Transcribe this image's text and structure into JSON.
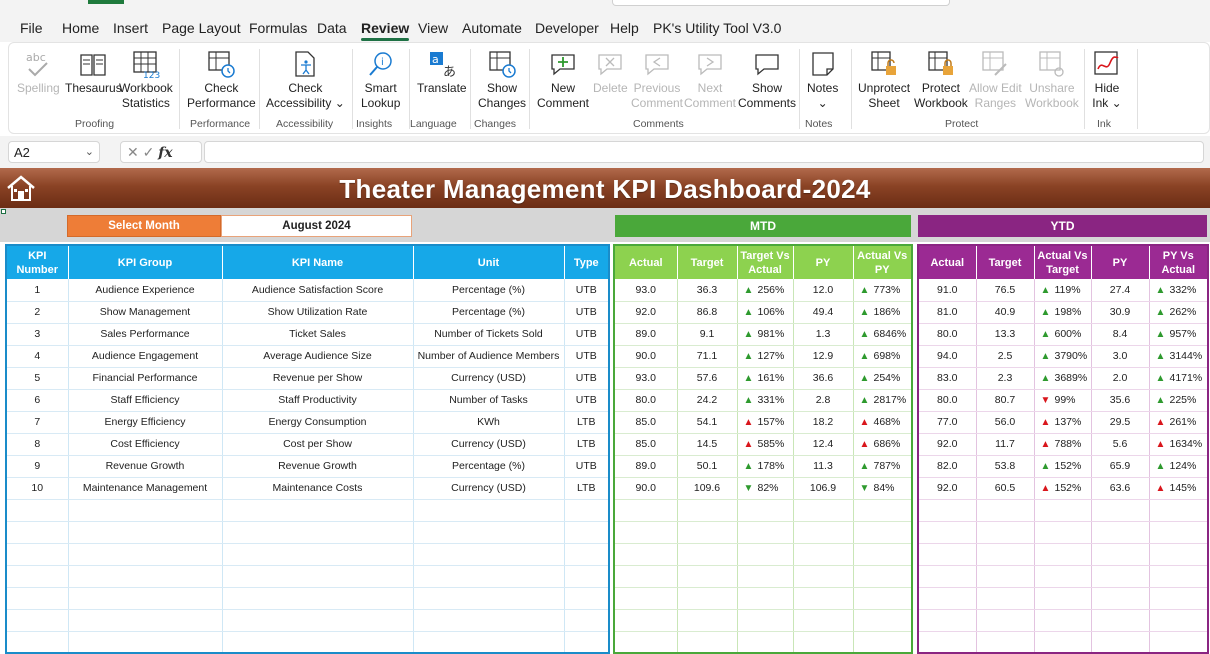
{
  "menu": {
    "tabs": [
      "File",
      "Home",
      "Insert",
      "Page Layout",
      "Formulas",
      "Data",
      "Review",
      "View",
      "Automate",
      "Developer",
      "Help",
      "PK's Utility Tool V3.0"
    ],
    "active": "Review"
  },
  "ribbon": {
    "buttons": {
      "spelling": "Spelling",
      "thesaurus": "Thesaurus",
      "workbook_stats_1": "Workbook",
      "workbook_stats_2": "Statistics",
      "check_perf_1": "Check",
      "check_perf_2": "Performance",
      "check_access_1": "Check",
      "check_access_2": "Accessibility",
      "smart_lookup_1": "Smart",
      "smart_lookup_2": "Lookup",
      "translate": "Translate",
      "show_changes_1": "Show",
      "show_changes_2": "Changes",
      "new_comment_1": "New",
      "new_comment_2": "Comment",
      "delete": "Delete",
      "previous_1": "Previous",
      "previous_2": "Comment",
      "next_1": "Next",
      "next_2": "Comment",
      "show_comments_1": "Show",
      "show_comments_2": "Comments",
      "notes": "Notes",
      "unprotect_1": "Unprotect",
      "unprotect_2": "Sheet",
      "protect_wb_1": "Protect",
      "protect_wb_2": "Workbook",
      "allow_edit_1": "Allow Edit",
      "allow_edit_2": "Ranges",
      "unshare_1": "Unshare",
      "unshare_2": "Workbook",
      "hide_ink_1": "Hide",
      "hide_ink_2": "Ink"
    },
    "groups": {
      "proofing": "Proofing",
      "performance": "Performance",
      "accessibility": "Accessibility",
      "insights": "Insights",
      "language": "Language",
      "changes": "Changes",
      "comments": "Comments",
      "notes": "Notes",
      "protect": "Protect",
      "ink": "Ink"
    }
  },
  "formula_bar": {
    "name_box": "A2",
    "fx": "fx",
    "formula": ""
  },
  "dashboard": {
    "title": "Theater Management KPI Dashboard-2024",
    "select_month_label": "Select Month",
    "select_month_value": "August 2024",
    "mtd_label": "MTD",
    "ytd_label": "YTD",
    "colors": {
      "banner": "#8a4325",
      "select_month": "#ee7d37",
      "kpi_header": "#16a8e8",
      "mtd": "#4aa83a",
      "mtd_header": "#8dd24f",
      "ytd": "#8a2582",
      "arrow_good": "#2e9a2e",
      "arrow_bad": "#d9161c"
    }
  },
  "kpi_headers": [
    "KPI Number",
    "KPI Group",
    "KPI Name",
    "Unit",
    "Type"
  ],
  "mtd_headers": [
    "Actual",
    "Target",
    "Target Vs Actual",
    "PY",
    "Actual Vs PY"
  ],
  "ytd_headers": [
    "Actual",
    "Target",
    "Actual Vs Target",
    "PY",
    "PY Vs Actual"
  ],
  "rows": [
    {
      "num": "1",
      "group": "Audience Experience",
      "name": "Audience Satisfaction Score",
      "unit": "Percentage (%)",
      "type": "UTB",
      "mtd": {
        "actual": "93.0",
        "target": "36.3",
        "tva": "256%",
        "tva_dir": "up-good",
        "py": "12.0",
        "avp": "773%",
        "avp_dir": "up-good"
      },
      "ytd": {
        "actual": "91.0",
        "target": "76.5",
        "avt": "119%",
        "avt_dir": "up-good",
        "py": "27.4",
        "pva": "332%",
        "pva_dir": "up-good"
      }
    },
    {
      "num": "2",
      "group": "Show Management",
      "name": "Show Utilization Rate",
      "unit": "Percentage (%)",
      "type": "UTB",
      "mtd": {
        "actual": "92.0",
        "target": "86.8",
        "tva": "106%",
        "tva_dir": "up-good",
        "py": "49.4",
        "avp": "186%",
        "avp_dir": "up-good"
      },
      "ytd": {
        "actual": "81.0",
        "target": "40.9",
        "avt": "198%",
        "avt_dir": "up-good",
        "py": "30.9",
        "pva": "262%",
        "pva_dir": "up-good"
      }
    },
    {
      "num": "3",
      "group": "Sales Performance",
      "name": "Ticket Sales",
      "unit": "Number of Tickets Sold",
      "type": "UTB",
      "mtd": {
        "actual": "89.0",
        "target": "9.1",
        "tva": "981%",
        "tva_dir": "up-good",
        "py": "1.3",
        "avp": "6846%",
        "avp_dir": "up-good"
      },
      "ytd": {
        "actual": "80.0",
        "target": "13.3",
        "avt": "600%",
        "avt_dir": "up-good",
        "py": "8.4",
        "pva": "957%",
        "pva_dir": "up-good"
      }
    },
    {
      "num": "4",
      "group": "Audience Engagement",
      "name": "Average Audience Size",
      "unit": "Number of Audience Members",
      "type": "UTB",
      "mtd": {
        "actual": "90.0",
        "target": "71.1",
        "tva": "127%",
        "tva_dir": "up-good",
        "py": "12.9",
        "avp": "698%",
        "avp_dir": "up-good"
      },
      "ytd": {
        "actual": "94.0",
        "target": "2.5",
        "avt": "3790%",
        "avt_dir": "up-good",
        "py": "3.0",
        "pva": "3144%",
        "pva_dir": "up-good"
      }
    },
    {
      "num": "5",
      "group": "Financial Performance",
      "name": "Revenue per Show",
      "unit": "Currency (USD)",
      "type": "UTB",
      "mtd": {
        "actual": "93.0",
        "target": "57.6",
        "tva": "161%",
        "tva_dir": "up-good",
        "py": "36.6",
        "avp": "254%",
        "avp_dir": "up-good"
      },
      "ytd": {
        "actual": "83.0",
        "target": "2.3",
        "avt": "3689%",
        "avt_dir": "up-good",
        "py": "2.0",
        "pva": "4171%",
        "pva_dir": "up-good"
      }
    },
    {
      "num": "6",
      "group": "Staff Efficiency",
      "name": "Staff Productivity",
      "unit": "Number of Tasks",
      "type": "UTB",
      "mtd": {
        "actual": "80.0",
        "target": "24.2",
        "tva": "331%",
        "tva_dir": "up-good",
        "py": "2.8",
        "avp": "2817%",
        "avp_dir": "up-good"
      },
      "ytd": {
        "actual": "80.0",
        "target": "80.7",
        "avt": "99%",
        "avt_dir": "down-bad",
        "py": "35.6",
        "pva": "225%",
        "pva_dir": "up-good"
      }
    },
    {
      "num": "7",
      "group": "Energy Efficiency",
      "name": "Energy Consumption",
      "unit": "KWh",
      "type": "LTB",
      "mtd": {
        "actual": "85.0",
        "target": "54.1",
        "tva": "157%",
        "tva_dir": "up-bad",
        "py": "18.2",
        "avp": "468%",
        "avp_dir": "up-bad"
      },
      "ytd": {
        "actual": "77.0",
        "target": "56.0",
        "avt": "137%",
        "avt_dir": "up-bad",
        "py": "29.5",
        "pva": "261%",
        "pva_dir": "up-bad"
      }
    },
    {
      "num": "8",
      "group": "Cost Efficiency",
      "name": "Cost per Show",
      "unit": "Currency (USD)",
      "type": "LTB",
      "mtd": {
        "actual": "85.0",
        "target": "14.5",
        "tva": "585%",
        "tva_dir": "up-bad",
        "py": "12.4",
        "avp": "686%",
        "avp_dir": "up-bad"
      },
      "ytd": {
        "actual": "92.0",
        "target": "11.7",
        "avt": "788%",
        "avt_dir": "up-bad",
        "py": "5.6",
        "pva": "1634%",
        "pva_dir": "up-bad"
      }
    },
    {
      "num": "9",
      "group": "Revenue Growth",
      "name": "Revenue Growth",
      "unit": "Percentage (%)",
      "type": "UTB",
      "mtd": {
        "actual": "89.0",
        "target": "50.1",
        "tva": "178%",
        "tva_dir": "up-good",
        "py": "11.3",
        "avp": "787%",
        "avp_dir": "up-good"
      },
      "ytd": {
        "actual": "82.0",
        "target": "53.8",
        "avt": "152%",
        "avt_dir": "up-good",
        "py": "65.9",
        "pva": "124%",
        "pva_dir": "up-good"
      }
    },
    {
      "num": "10",
      "group": "Maintenance Management",
      "name": "Maintenance Costs",
      "unit": "Currency (USD)",
      "type": "LTB",
      "mtd": {
        "actual": "90.0",
        "target": "109.6",
        "tva": "82%",
        "tva_dir": "down-good",
        "py": "106.9",
        "avp": "84%",
        "avp_dir": "down-good"
      },
      "ytd": {
        "actual": "92.0",
        "target": "60.5",
        "avt": "152%",
        "avt_dir": "up-bad",
        "py": "63.6",
        "pva": "145%",
        "pva_dir": "up-bad"
      }
    }
  ]
}
